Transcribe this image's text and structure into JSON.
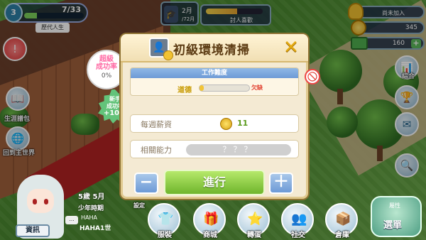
{
  "hud": {
    "level": "3",
    "exp": "7/33",
    "era": "歷代人生",
    "clock_month": "2月",
    "clock_day": "/72月",
    "fan_label": "討人喜歡",
    "trophy_label": "尚未加入",
    "coins": "345",
    "cash": "160",
    "plus": "+"
  },
  "left_menu": {
    "life_album": "生涯譜包",
    "back_world": "回到主世界"
  },
  "right_menu": {
    "overview": "綜合"
  },
  "dialog": {
    "title": "初級環境清掃",
    "close": "✕",
    "difficulty_header": "工作難度",
    "moral_label": "道德",
    "moral_warn": "欠缺",
    "moral_level": 0.08,
    "wage_label": "每週薪資",
    "wage_value": "11",
    "ability_label": "相關能力",
    "ability_value": "？？？",
    "minus": "−",
    "plus": "＋",
    "go": "進行"
  },
  "success_bubble": {
    "line1": "超級",
    "line2": "成功率",
    "rate": "0%"
  },
  "novice_star": {
    "line1": "新手",
    "line2": "成功率",
    "rate": "+10%"
  },
  "player": {
    "age": "5歲",
    "month": "5月",
    "period": "少年時期",
    "info_button": "資訊",
    "dots": "...",
    "name_small": "HAHA",
    "name": "HAHA1世"
  },
  "bottom_bar": {
    "clothes": "服裝",
    "shop": "商城",
    "gacha": "轉蛋",
    "social": "社交",
    "storage": "倉庫",
    "setting": "設定",
    "menu_sub": "屬性",
    "menu": "選單"
  },
  "colors": {
    "accent_green": "#6fb52c",
    "title_brown": "#5b3a12",
    "header_blue": "#6d9ad6",
    "warn_red": "#e03a2a"
  }
}
